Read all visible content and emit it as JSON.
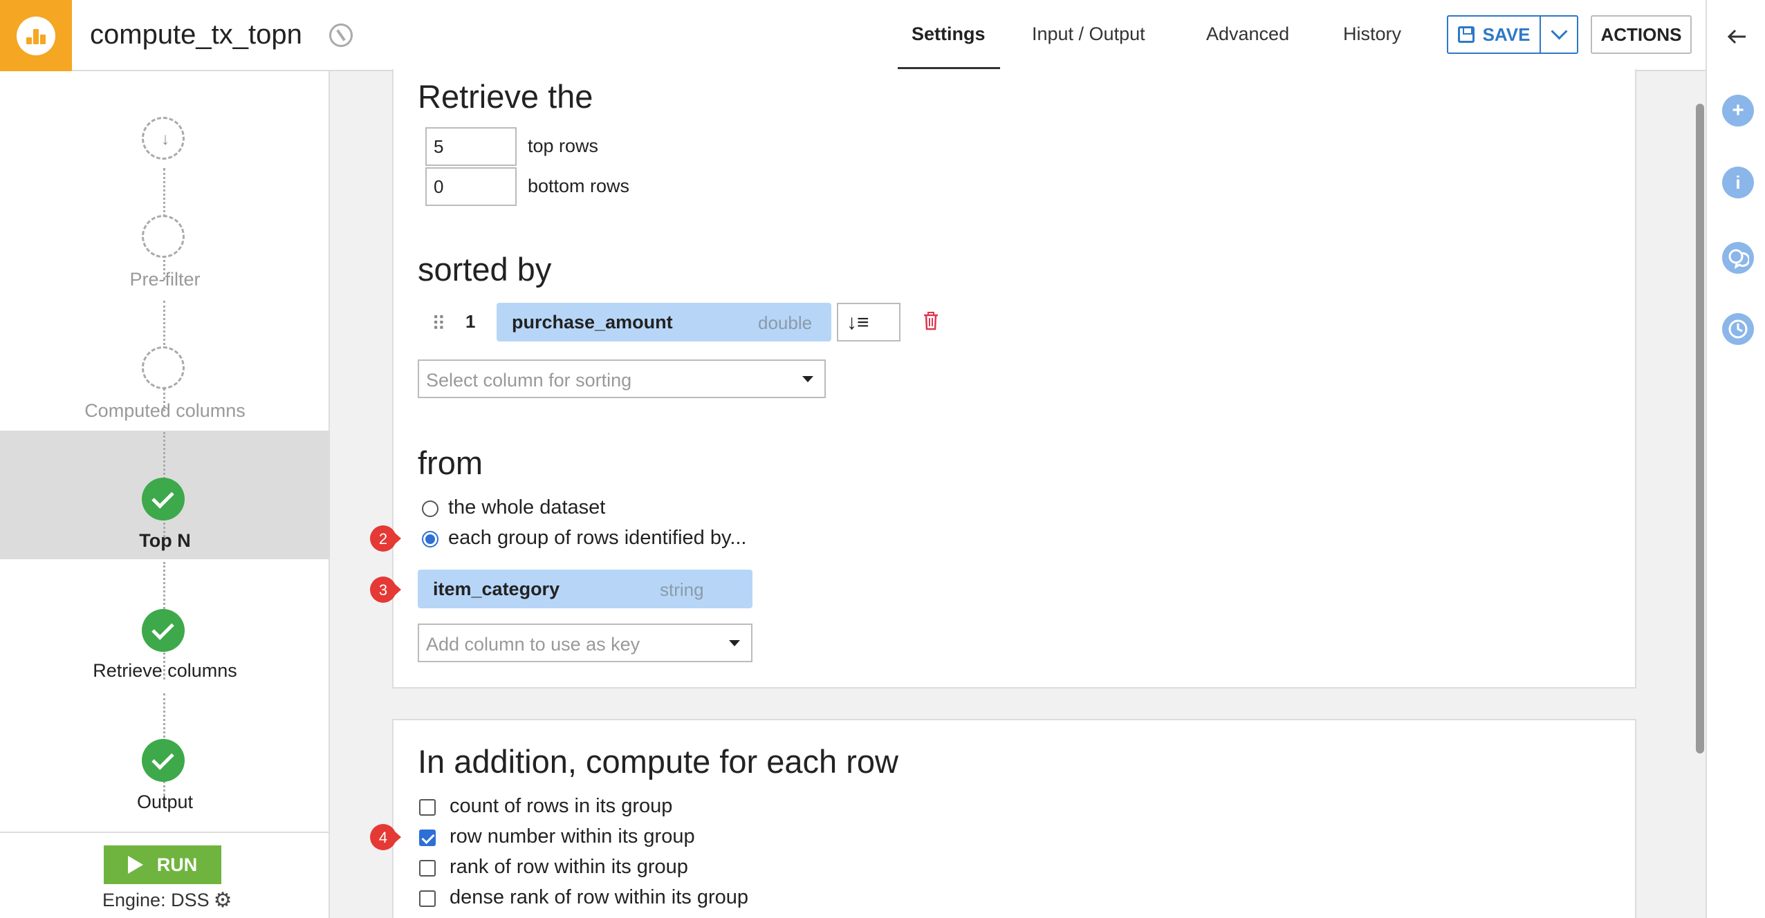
{
  "header": {
    "recipe_name": "compute_tx_topn",
    "tabs": [
      {
        "label": "Settings",
        "active": true
      },
      {
        "label": "Input / Output"
      },
      {
        "label": "Advanced"
      },
      {
        "label": "History"
      }
    ],
    "save_label": "SAVE",
    "actions_label": "ACTIONS"
  },
  "sidebar": {
    "steps": [
      {
        "label": "Pre-filter",
        "status": "inactive"
      },
      {
        "label": "Computed columns",
        "status": "inactive"
      },
      {
        "label": "Top N",
        "status": "done",
        "active": true
      },
      {
        "label": "Retrieve columns",
        "status": "done"
      },
      {
        "label": "Output",
        "status": "done"
      }
    ],
    "run_label": "RUN",
    "engine_label": "Engine: DSS"
  },
  "retrieve": {
    "title": "Retrieve the",
    "top_rows_value": "5",
    "top_rows_label": "top rows",
    "bottom_rows_value": "0",
    "bottom_rows_label": "bottom rows"
  },
  "sorted_by": {
    "title": "sorted by",
    "rank": "1",
    "column_name": "purchase_amount",
    "column_type": "double",
    "select_placeholder": "Select column for sorting"
  },
  "from": {
    "title": "from",
    "option_whole": "the whole dataset",
    "option_group": "each group of rows identified by...",
    "selected": "group",
    "key_column_name": "item_category",
    "key_column_type": "string",
    "key_placeholder": "Add column to use as key"
  },
  "compute": {
    "title": "In addition, compute for each row",
    "options": [
      {
        "label": "count of rows in its group",
        "checked": false
      },
      {
        "label": "row number within its group",
        "checked": true
      },
      {
        "label": "rank of row within its group",
        "checked": false
      },
      {
        "label": "dense rank of row within its group",
        "checked": false
      }
    ]
  },
  "annotations": {
    "badge_2": "2",
    "badge_3": "3",
    "badge_4": "4"
  },
  "colors": {
    "brand": "#f5a623",
    "accent": "#2d78c8",
    "success": "#3da94a",
    "run": "#6fb43f",
    "pill": "#b7d6f7",
    "annotation": "#e53935"
  }
}
